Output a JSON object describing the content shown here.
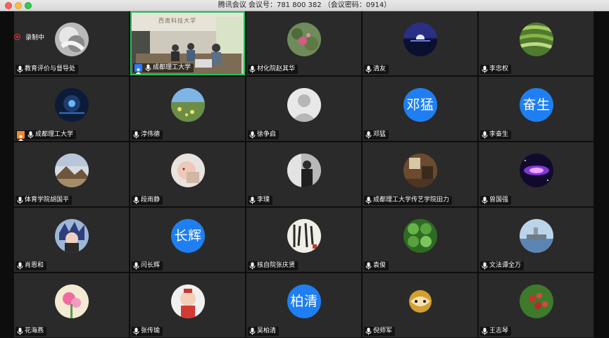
{
  "window": {
    "title": "腾讯会议 会议号：781 800 382 （会议密码：0914）"
  },
  "recording": {
    "label": "录制中"
  },
  "video_banner": "西南科技大学",
  "participants": [
    {
      "name": "教育评价与督导处",
      "avatar": "photo-hand",
      "row": 0,
      "col": 0
    },
    {
      "name": "成都理工大学",
      "avatar": "live-video",
      "row": 0,
      "col": 1,
      "active": true,
      "badge": "blue"
    },
    {
      "name": "材化院赵其华",
      "avatar": "photo-flowers",
      "row": 0,
      "col": 2
    },
    {
      "name": "清友",
      "avatar": "photo-night-lake",
      "row": 0,
      "col": 3
    },
    {
      "name": "李忠权",
      "avatar": "photo-terraces",
      "row": 0,
      "col": 4
    },
    {
      "name": "成都理工大学",
      "avatar": "photo-night-city",
      "row": 1,
      "col": 0,
      "badge": "orange"
    },
    {
      "name": "淳伟德",
      "avatar": "photo-field",
      "row": 1,
      "col": 1
    },
    {
      "name": "徐争启",
      "avatar": "default-person",
      "row": 1,
      "col": 2
    },
    {
      "name": "邓猛",
      "avatar_text": "邓猛",
      "row": 1,
      "col": 3
    },
    {
      "name": "李奋生",
      "avatar_text": "奋生",
      "row": 1,
      "col": 4
    },
    {
      "name": "体育学院胡国平",
      "avatar": "photo-mountain",
      "row": 2,
      "col": 0
    },
    {
      "name": "段雨静",
      "avatar": "photo-baby",
      "row": 2,
      "col": 1
    },
    {
      "name": "李璞",
      "avatar": "photo-man-bw",
      "row": 2,
      "col": 2
    },
    {
      "name": "成都理工大学传艺学院田力",
      "avatar": "photo-room",
      "row": 2,
      "col": 3
    },
    {
      "name": "曾国强",
      "avatar": "photo-galaxy",
      "row": 2,
      "col": 4
    },
    {
      "name": "肖恩和",
      "avatar": "photo-anime",
      "row": 3,
      "col": 0
    },
    {
      "name": "闫长辉",
      "avatar_text": "长辉",
      "row": 3,
      "col": 1
    },
    {
      "name": "核自院张庆贤",
      "avatar": "photo-calligraphy",
      "row": 3,
      "col": 2
    },
    {
      "name": "袁俊",
      "avatar": "photo-clover",
      "row": 3,
      "col": 3
    },
    {
      "name": "文法谭全万",
      "avatar": "photo-ship",
      "row": 3,
      "col": 4
    },
    {
      "name": "花海燕",
      "avatar": "photo-pink-flower",
      "row": 4,
      "col": 0
    },
    {
      "name": "张传瑜",
      "avatar": "photo-child",
      "row": 4,
      "col": 1
    },
    {
      "name": "吴柏清",
      "avatar_text": "柏清",
      "row": 4,
      "col": 2
    },
    {
      "name": "倪师军",
      "avatar": "photo-opera",
      "row": 4,
      "col": 3
    },
    {
      "name": "王志琴",
      "avatar": "photo-berries",
      "row": 4,
      "col": 4
    }
  ],
  "colors": {
    "tile_bg": "#2a2a2a",
    "avatar_blue": "#1f7ff2",
    "active_border": "#22c05a",
    "record_red": "#e33333"
  }
}
